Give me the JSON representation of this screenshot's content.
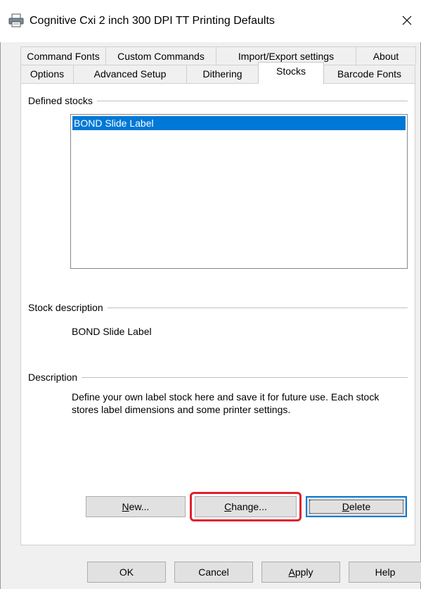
{
  "window": {
    "title": "Cognitive Cxi 2 inch 300 DPI TT Printing Defaults",
    "icon": "printer-icon",
    "close_glyph": "✕"
  },
  "tabs": {
    "row1": [
      "Command Fonts",
      "Custom Commands",
      "Import/Export settings",
      "About"
    ],
    "row2": [
      "Options",
      "Advanced Setup",
      "Dithering",
      "Stocks",
      "Barcode Fonts"
    ],
    "selected": "Stocks"
  },
  "defined_stocks": {
    "label": "Defined stocks",
    "items": [
      "BOND Slide Label"
    ],
    "selected_index": 0
  },
  "stock_description": {
    "label": "Stock description",
    "value": "BOND Slide Label"
  },
  "description": {
    "label": "Description",
    "text": "Define your own label stock here and save it for future use. Each stock stores label dimensions and some printer settings."
  },
  "stock_buttons": {
    "new": {
      "accel": "N",
      "rest": "ew..."
    },
    "change": {
      "accel": "C",
      "rest": "hange..."
    },
    "delete": {
      "accel": "D",
      "rest": "elete"
    }
  },
  "dialog_buttons": {
    "ok": "OK",
    "cancel": "Cancel",
    "apply": {
      "accel": "A",
      "rest": "pply"
    },
    "help": "Help"
  },
  "colors": {
    "selection": "#0078d7",
    "highlight": "#e0202c",
    "dialog_bg": "#f0f0f0"
  }
}
